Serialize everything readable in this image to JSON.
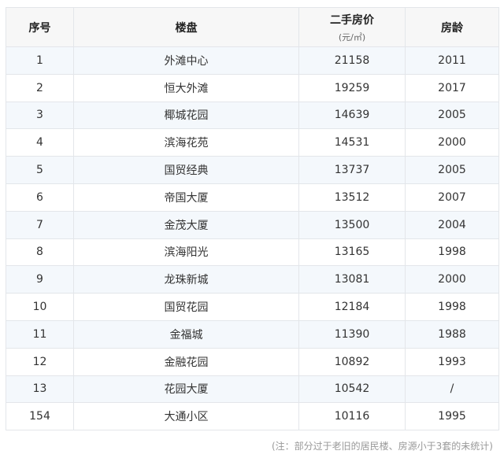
{
  "table": {
    "headers": {
      "index": "序号",
      "estate": "楼盘",
      "price": "二手房价",
      "price_unit": "(元/㎡)",
      "age": "房龄"
    },
    "rows": [
      {
        "index": "1",
        "estate": "外滩中心",
        "price": "21158",
        "age": "2011"
      },
      {
        "index": "2",
        "estate": "恒大外滩",
        "price": "19259",
        "age": "2017"
      },
      {
        "index": "3",
        "estate": "椰城花园",
        "price": "14639",
        "age": "2005"
      },
      {
        "index": "4",
        "estate": "滨海花苑",
        "price": "14531",
        "age": "2000"
      },
      {
        "index": "5",
        "estate": "国贸经典",
        "price": "13737",
        "age": "2005"
      },
      {
        "index": "6",
        "estate": "帝国大厦",
        "price": "13512",
        "age": "2007"
      },
      {
        "index": "7",
        "estate": "金茂大厦",
        "price": "13500",
        "age": "2004"
      },
      {
        "index": "8",
        "estate": "滨海阳光",
        "price": "13165",
        "age": "1998"
      },
      {
        "index": "9",
        "estate": "龙珠新城",
        "price": "13081",
        "age": "2000"
      },
      {
        "index": "10",
        "estate": "国贸花园",
        "price": "12184",
        "age": "1998"
      },
      {
        "index": "11",
        "estate": "金福城",
        "price": "11390",
        "age": "1988"
      },
      {
        "index": "12",
        "estate": "金融花园",
        "price": "10892",
        "age": "1993"
      },
      {
        "index": "13",
        "estate": "花园大厦",
        "price": "10542",
        "age": "/"
      },
      {
        "index": "154",
        "estate": "大通小区",
        "price": "10116",
        "age": "1995"
      }
    ]
  },
  "note": "(注：部分过于老旧的居民楼、房源小于3套的未统计)"
}
